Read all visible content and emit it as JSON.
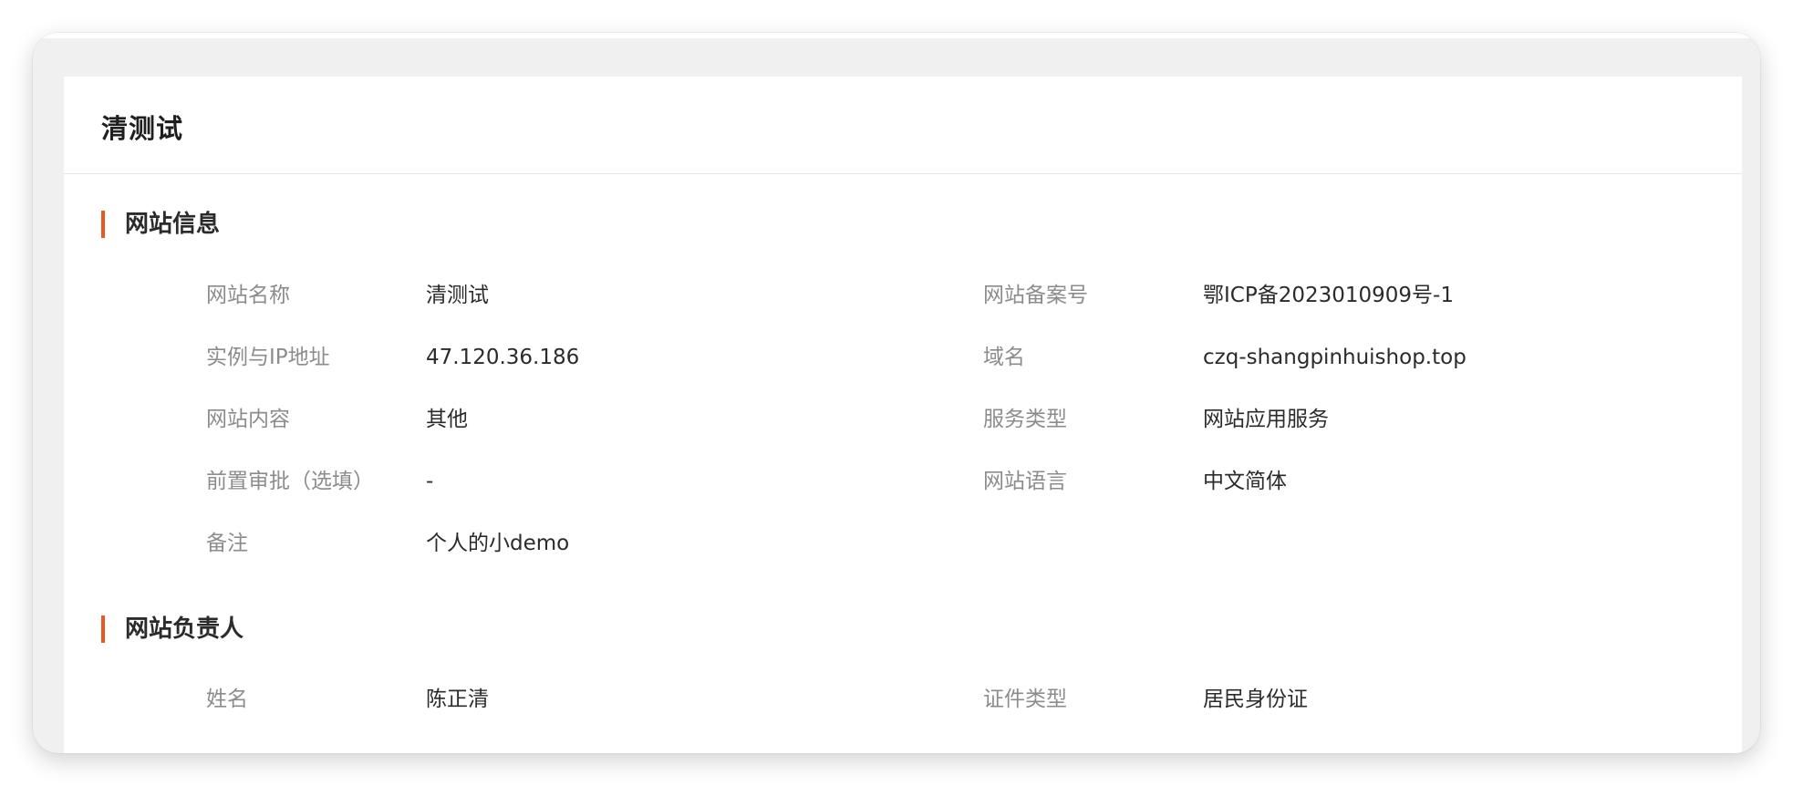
{
  "page": {
    "title": "清测试"
  },
  "sections": [
    {
      "title": "网站信息",
      "rows": [
        [
          {
            "label": "网站名称",
            "value": "清测试"
          },
          {
            "label": "网站备案号",
            "value": "鄂ICP备2023010909号-1"
          }
        ],
        [
          {
            "label": "实例与IP地址",
            "value": "47.120.36.186"
          },
          {
            "label": "域名",
            "value": "czq-shangpinhuishop.top"
          }
        ],
        [
          {
            "label": "网站内容",
            "value": "其他"
          },
          {
            "label": "服务类型",
            "value": "网站应用服务"
          }
        ],
        [
          {
            "label": "前置审批（选填）",
            "value": "-"
          },
          {
            "label": "网站语言",
            "value": "中文简体"
          }
        ],
        [
          {
            "label": "备注",
            "value": "个人的小demo"
          }
        ]
      ]
    },
    {
      "title": "网站负责人",
      "rows": [
        [
          {
            "label": "姓名",
            "value": "陈正清"
          },
          {
            "label": "证件类型",
            "value": "居民身份证"
          }
        ]
      ]
    }
  ],
  "colors": {
    "accent": "#e8591f",
    "label": "#8c8c8c",
    "value": "#2b2b2b",
    "panel_bg": "#ffffff",
    "window_bg": "#f0f0f0"
  }
}
